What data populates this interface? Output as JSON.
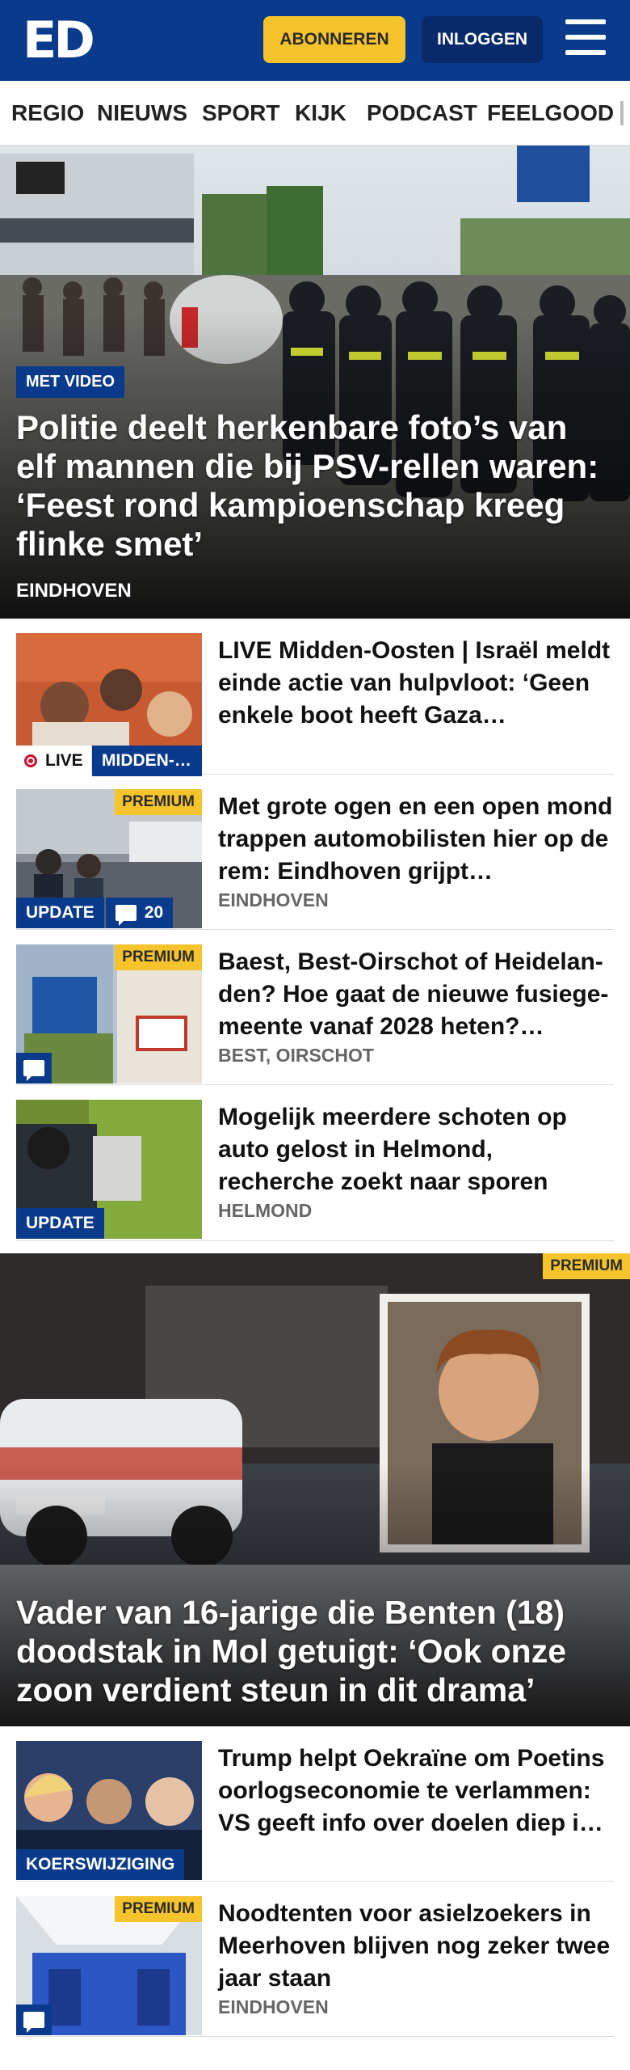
{
  "header": {
    "logo": "ED",
    "subscribe_label": "ABONNEREN",
    "login_label": "INLOGGEN",
    "colors": {
      "brand": "#0a3a8c",
      "accent": "#f5c42c"
    }
  },
  "nav": {
    "items": [
      "REGIO",
      "NIEUWS",
      "SPORT",
      "KIJK",
      "PODCAST",
      "FEELGOOD"
    ]
  },
  "hero": {
    "tag": "MET VIDEO",
    "title": "Politie deelt herkenbare foto’s van elf mannen die bij PSV-rellen waren: ‘Feest rond kampioenschap kreeg flinke smet’",
    "location": "EINDHOVEN"
  },
  "articles": [
    {
      "title": "LIVE Midden-Oosten | Israël meldt einde actie van hulpvloot: ‘Geen enkele boot heeft Gaza…",
      "live_label": "LIVE",
      "badge": "MIDDEN-…"
    },
    {
      "premium": "PREMIUM",
      "title": "Met grote ogen en een open mond trappen automobilisten hier op de rem: Eindhoven grijpt…",
      "location": "EINDHOVEN",
      "badge": "UPDATE",
      "comments": "20"
    },
    {
      "premium": "PREMIUM",
      "title": "Baest, Best-Oirschot of Heidelan-den? Hoe gaat de nieuwe fusiege-meente vanaf 2028 heten?…",
      "location": "BEST, OIRSCHOT"
    },
    {
      "title": "Mogelijk meerdere schoten op auto gelost in Helmond, recherche zoekt naar sporen",
      "location": "HELMOND",
      "badge": "UPDATE"
    }
  ],
  "feature": {
    "premium": "PREMIUM",
    "title": "Vader van 16-jarige die Benten (18) doodstak in Mol getuigt: ‘Ook onze zoon verdient steun in dit drama’"
  },
  "articles2": [
    {
      "title": "Trump helpt Oekraïne om Poetins oorlogseconomie te verlammen: VS geeft info over doelen diep i…",
      "badge": "KOERSWIJZIGING"
    },
    {
      "premium": "PREMIUM",
      "title": "Noodtenten voor asielzoekers in Meerhoven blijven nog zeker twee jaar staan",
      "location": "EINDHOVEN"
    }
  ]
}
